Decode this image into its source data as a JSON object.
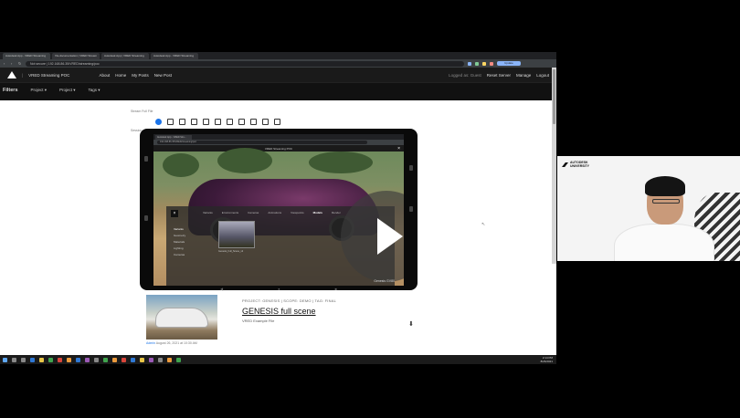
{
  "browser": {
    "tabs": [
      {
        "label": "Autodesk App - VRED Streaming"
      },
      {
        "label": "Vis-documentation | VRED Stream"
      },
      {
        "label": "Autodesk App | VRED Streaming"
      },
      {
        "label": "Autodesk App - VRED Streaming"
      }
    ],
    "address": "Not secure | 192.168.86.35/VRED/streaming/poc",
    "update_label": "Update"
  },
  "app": {
    "brand": "VRED Streaming POC",
    "nav": [
      "About",
      "Home",
      "My Posts",
      "New Post"
    ],
    "user_status": "Logged as: Guest",
    "right_links": [
      "Reset Server",
      "Manage",
      "Logout"
    ]
  },
  "filters": {
    "title": "Filters",
    "dropdowns": [
      "Project ▾",
      "Project ▾",
      "Tags ▾"
    ]
  },
  "page": {
    "label_top": "Stream Full File",
    "label_mid": "Session"
  },
  "tablet": {
    "tab_label": "Autodesk App - VRED Stre...",
    "address": "192.168.86.35/VRED/streaming/poc",
    "app_title": "VRED Streaming POC",
    "close": "×",
    "panel_tabs": [
      "Variants",
      "Environments",
      "Cameras",
      "Animations",
      "Viewpoints",
      "Models",
      "Render"
    ],
    "panel_active_tab": "Models",
    "panel_items": [
      "Variants",
      "Geometry",
      "Materials",
      "Lighting",
      "Cameras"
    ],
    "panel_selected": "Variants",
    "thumb_label": "Genesis_Full_Scene_v2",
    "watermark": "Genesis GV80",
    "nav_icons": [
      "◀",
      "●",
      "■"
    ]
  },
  "post": {
    "tags": "PROJECT: GENESIS | SCOPE: DEMO | TAG: FINAL",
    "title": "GENESIS full scene",
    "subtitle": "VRED Example File",
    "author": "Admin",
    "date": "  August 26, 2021 at 10:30 AM"
  },
  "taskbar": {
    "clock": "2:14 PM",
    "date": "8/26/2021"
  },
  "webcam": {
    "logo_line1": "AUTODESK",
    "logo_line2": "UNIVERSITY"
  }
}
